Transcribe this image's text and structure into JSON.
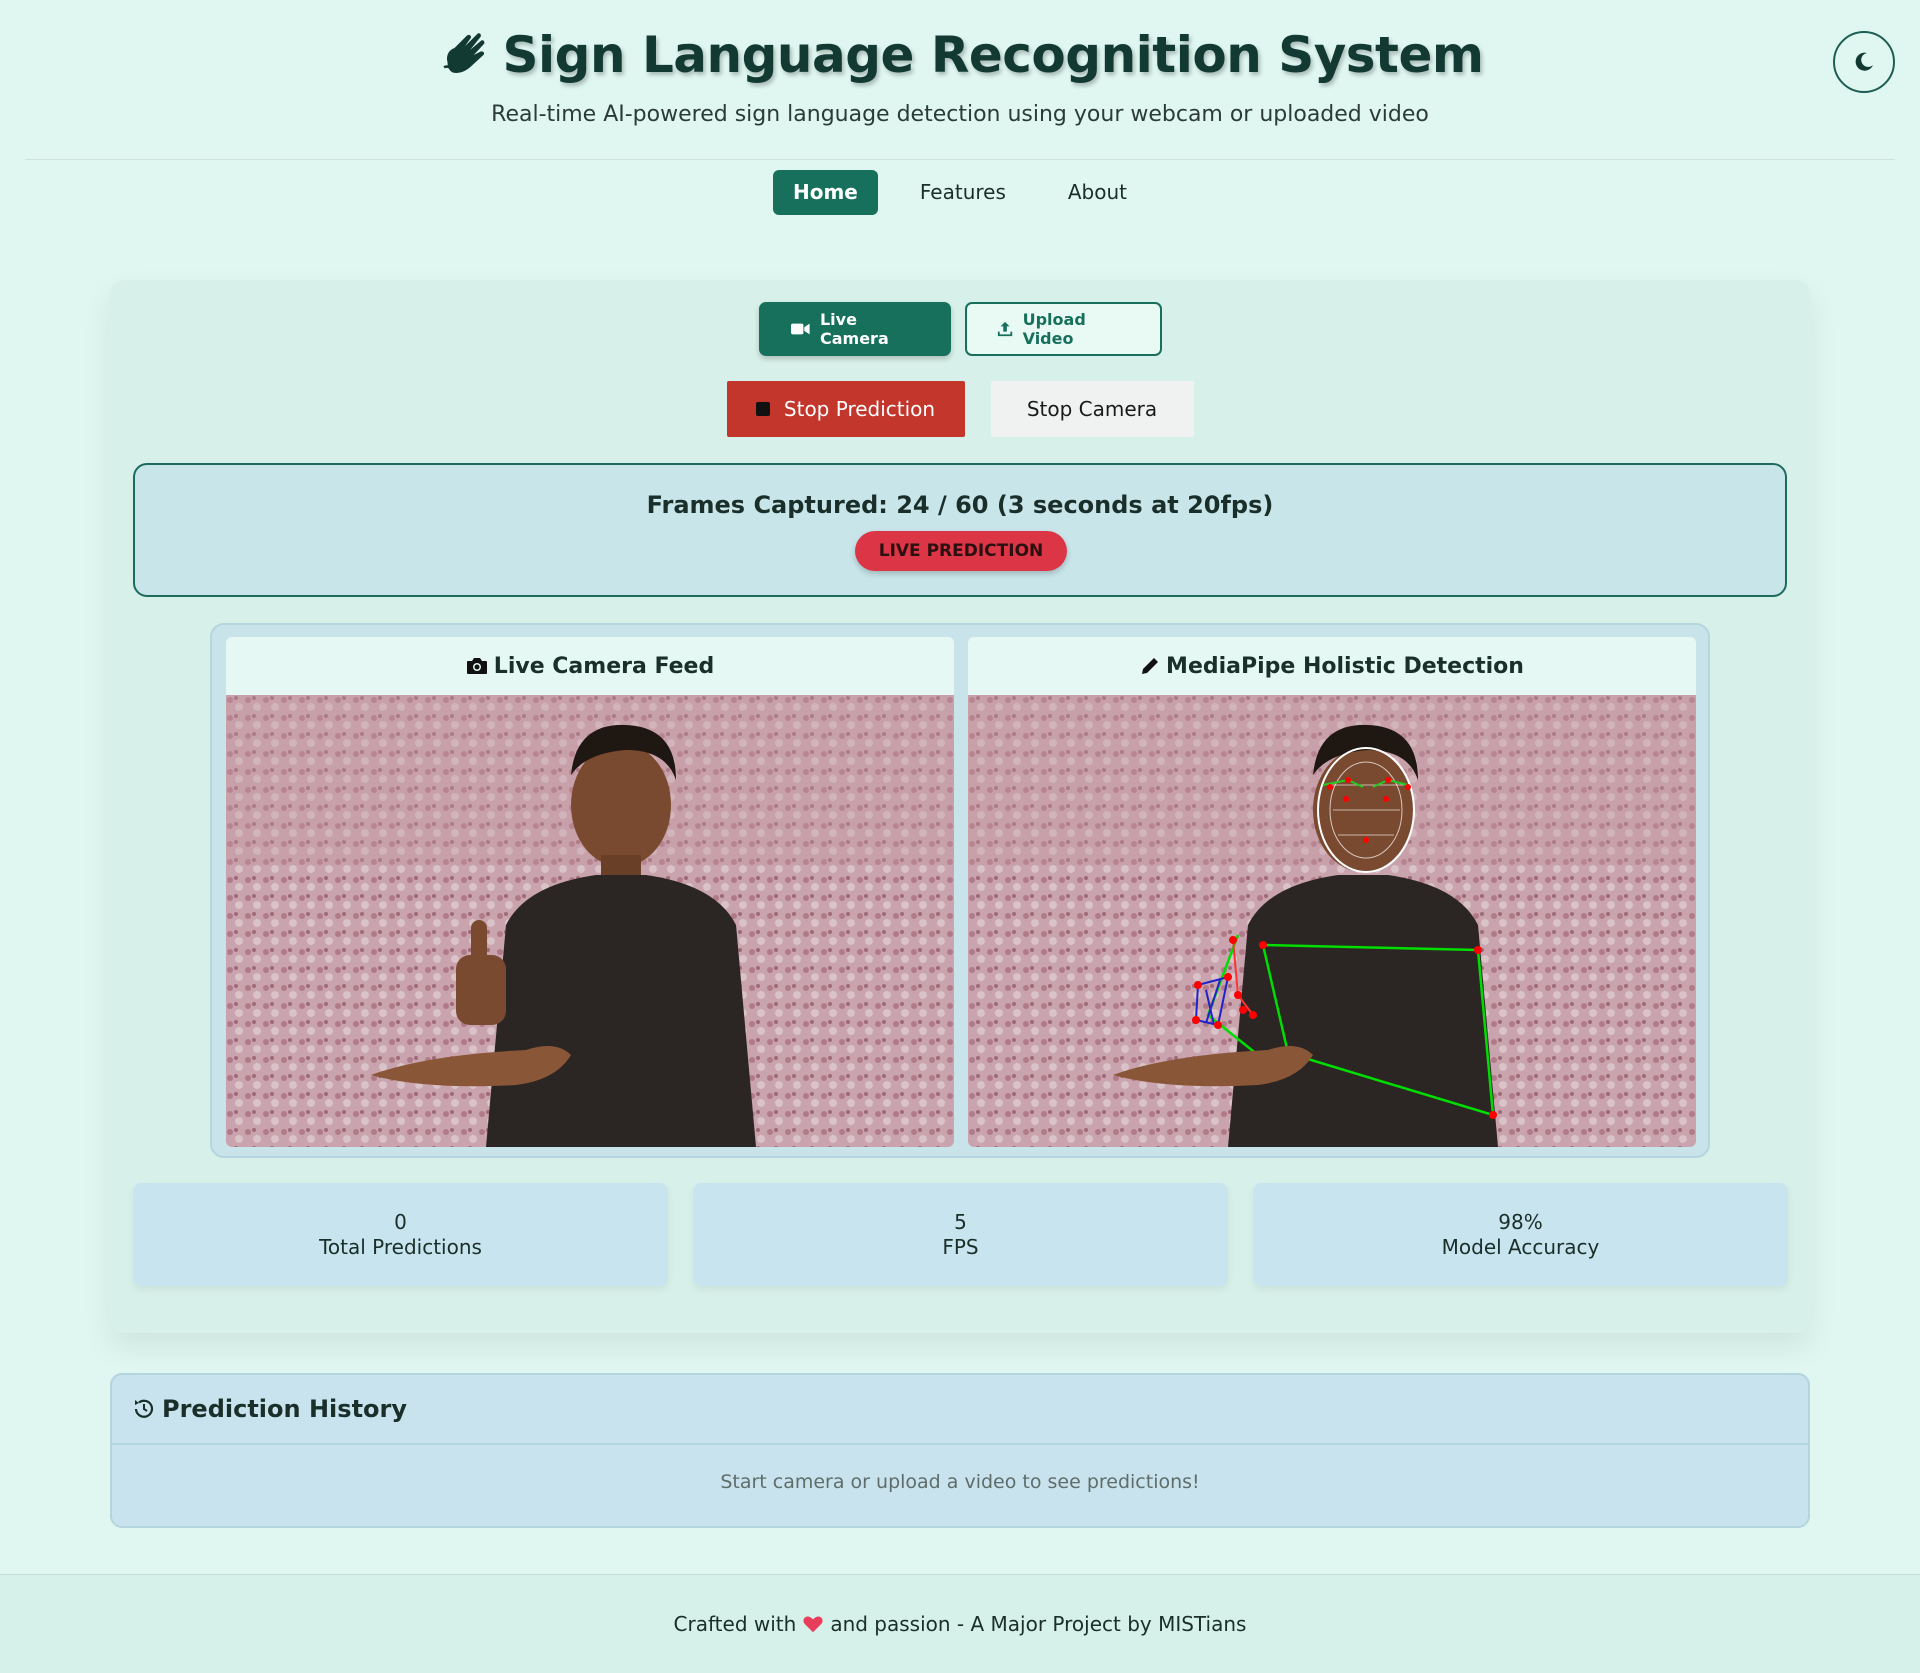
{
  "header": {
    "title": "Sign Language Recognition System",
    "subtitle": "Real-time AI-powered sign language detection using your webcam or uploaded video",
    "hand_icon": "sign-language-hand-icon",
    "theme_icon": "moon-icon"
  },
  "nav": {
    "items": [
      {
        "label": "Home",
        "active": true
      },
      {
        "label": "Features",
        "active": false
      },
      {
        "label": "About",
        "active": false
      }
    ]
  },
  "modes": {
    "live_camera": "Live Camera",
    "upload_video": "Upload Video"
  },
  "actions": {
    "stop_prediction": "Stop Prediction",
    "stop_camera": "Stop Camera"
  },
  "frames": {
    "text": "Frames Captured: 24 / 60 (3 seconds at 20fps)",
    "badge": "LIVE PREDICTION"
  },
  "feeds": {
    "left_title": "Live Camera Feed",
    "right_title": "MediaPipe Holistic Detection"
  },
  "stats": [
    {
      "value": "0",
      "label": "Total Predictions"
    },
    {
      "value": "5",
      "label": "FPS"
    },
    {
      "value": "98%",
      "label": "Model Accuracy"
    }
  ],
  "history": {
    "title": "Prediction History",
    "empty_text": "Start camera or upload a video to see predictions!"
  },
  "footer": {
    "before": "Crafted with",
    "after": "and passion - A Major Project by MISTians"
  },
  "colors": {
    "primary": "#17705c",
    "danger": "#c2362c",
    "badge": "#dc3545",
    "background": "#e0f7f1"
  }
}
